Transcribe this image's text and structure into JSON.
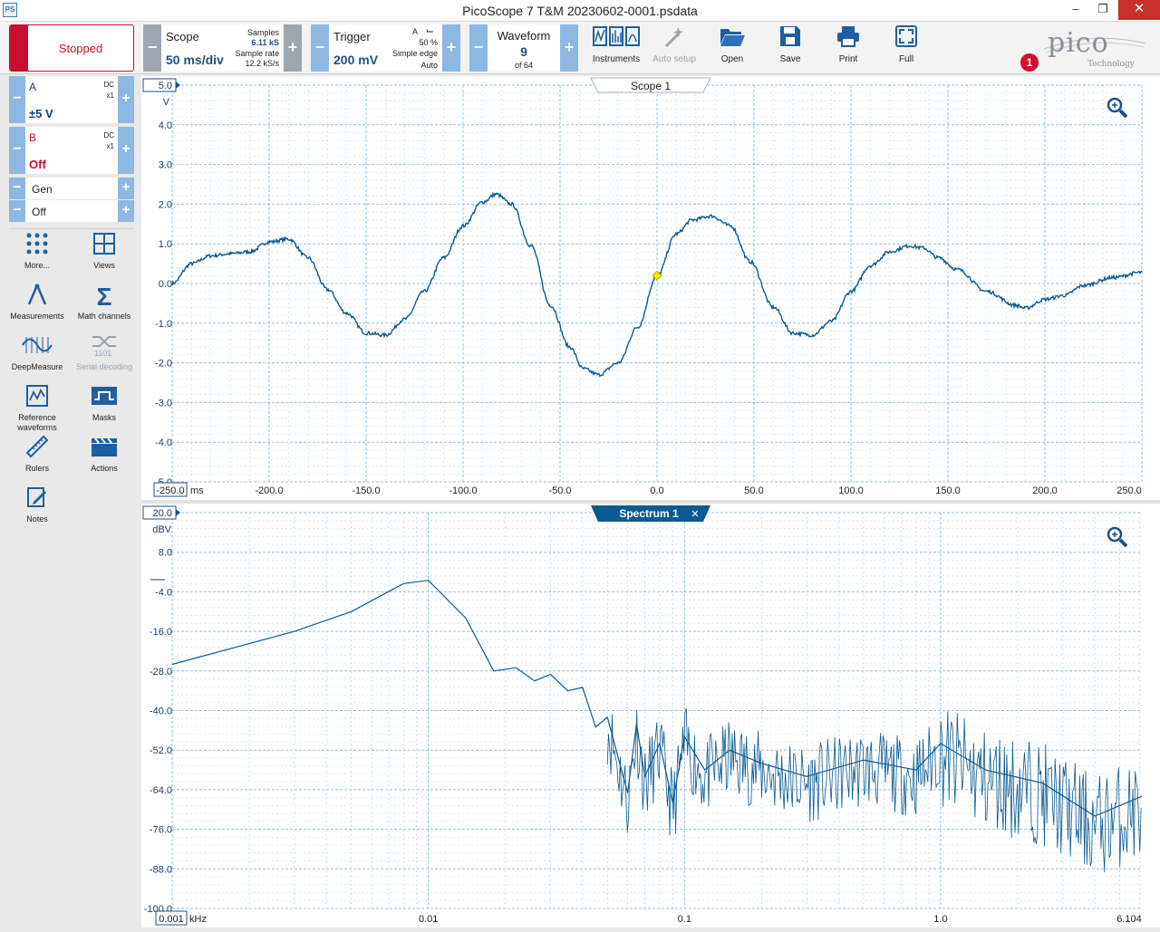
{
  "window": {
    "title": "PicoScope 7 T&M 20230602-0001.psdata",
    "app_icon": "PS"
  },
  "toolbar": {
    "status": "Stopped",
    "scope": {
      "title": "Scope",
      "value": "50 ms/div",
      "samples_label": "Samples",
      "samples_value": "6.11 kS",
      "rate_label": "Sample rate",
      "rate_value": "12.2 kS/s"
    },
    "trigger": {
      "title": "Trigger",
      "value": "200 mV",
      "channel": "A",
      "percent": "50 %",
      "type": "Simple edge",
      "mode": "Auto"
    },
    "waveform": {
      "title": "Waveform",
      "value": "9",
      "of": "of 64"
    },
    "buttons": [
      {
        "label": "Instruments",
        "icon": "instruments-icon"
      },
      {
        "label": "Auto setup",
        "icon": "auto-setup-icon"
      },
      {
        "label": "Open",
        "icon": "folder-open-icon"
      },
      {
        "label": "Save",
        "icon": "floppy-disk-icon"
      },
      {
        "label": "Print",
        "icon": "printer-icon"
      },
      {
        "label": "Full",
        "icon": "fullscreen-icon"
      }
    ],
    "logo": {
      "word": "pico",
      "sub": "Technology"
    },
    "notification_count": "1"
  },
  "channels": [
    {
      "name": "A",
      "coupling": "DC",
      "probe": "x1",
      "range": "±5 V",
      "color": "#1a3e66"
    },
    {
      "name": "B",
      "coupling": "DC",
      "probe": "x1",
      "range": "Off",
      "color": "#c8102e"
    }
  ],
  "generator": {
    "label": "Gen",
    "state": "Off"
  },
  "side_tools": [
    {
      "label": "More...",
      "icon": "more-dots-icon"
    },
    {
      "label": "Views",
      "icon": "views-grid-icon"
    },
    {
      "label": "Measurements",
      "icon": "measurements-icon"
    },
    {
      "label": "Math channels",
      "icon": "sigma-icon"
    },
    {
      "label": "DeepMeasure",
      "icon": "deepmeasure-icon"
    },
    {
      "label": "Serial decoding",
      "icon": "serial-decoding-icon"
    },
    {
      "label": "Reference waveforms",
      "icon": "reference-waveforms-icon"
    },
    {
      "label": "Masks",
      "icon": "masks-icon"
    },
    {
      "label": "Rulers",
      "icon": "ruler-icon"
    },
    {
      "label": "Actions",
      "icon": "clapperboard-icon"
    },
    {
      "label": "Notes",
      "icon": "notes-icon"
    }
  ],
  "chart_data": [
    {
      "type": "line",
      "title": "Scope 1",
      "ylabel": "V",
      "xlabel": "ms",
      "xlim": [
        -250,
        250
      ],
      "ylim": [
        -5,
        5
      ],
      "y_top_label": "5.0",
      "x_first_label": "-250.0",
      "x_ticks": [
        "-200.0",
        "-150.0",
        "-100.0",
        "-50.0",
        "0.0",
        "50.0",
        "100.0",
        "150.0",
        "200.0",
        "250.0"
      ],
      "y_ticks": [
        "4.0",
        "3.0",
        "2.0",
        "1.0",
        "0.0",
        "-1.0",
        "-2.0",
        "-3.0",
        "-4.0",
        "-5.0"
      ],
      "grid": true,
      "trigger_marker": {
        "x": 0,
        "y": 0.2
      },
      "series": [
        {
          "color": "#0b5a92",
          "x": [
            -250,
            -240,
            -230,
            -220,
            -210,
            -200,
            -190,
            -180,
            -170,
            -160,
            -150,
            -140,
            -130,
            -120,
            -110,
            -100,
            -90,
            -83,
            -75,
            -65,
            -55,
            -45,
            -38,
            -30,
            -20,
            -10,
            0,
            10,
            18,
            28,
            38,
            48,
            60,
            70,
            80,
            90,
            100,
            110,
            120,
            130,
            137,
            145,
            155,
            170,
            185,
            190,
            200,
            210,
            220,
            235,
            250
          ],
          "y": [
            0,
            0.5,
            0.7,
            0.75,
            0.8,
            1.05,
            1.12,
            0.65,
            -0.15,
            -0.75,
            -1.25,
            -1.3,
            -0.9,
            -0.2,
            0.65,
            1.45,
            2.05,
            2.25,
            2.0,
            0.95,
            -0.55,
            -1.6,
            -2.15,
            -2.3,
            -2.0,
            -1.1,
            0.2,
            1.25,
            1.6,
            1.7,
            1.45,
            0.55,
            -0.6,
            -1.25,
            -1.3,
            -0.95,
            -0.2,
            0.45,
            0.8,
            0.95,
            0.9,
            0.65,
            0.35,
            -0.2,
            -0.55,
            -0.62,
            -0.4,
            -0.3,
            -0.05,
            0.15,
            0.28
          ]
        }
      ]
    },
    {
      "type": "line",
      "title": "Spectrum 1",
      "ylabel": "dBV",
      "xlabel": "kHz",
      "x_scale": "log",
      "xlim": [
        0.001,
        6.104
      ],
      "ylim": [
        -100,
        20
      ],
      "y_top_label": "20.0",
      "x_first_label": "0.001",
      "x_ticks": [
        "0.01",
        "0.1",
        "1.0",
        "6.104"
      ],
      "y_ticks": [
        "8.0",
        "-4.0",
        "-16.0",
        "-28.0",
        "-40.0",
        "-52.0",
        "-64.0",
        "-76.0",
        "-88.0",
        "-100.0"
      ],
      "grid": true,
      "series": [
        {
          "color": "#0b5a92",
          "x": [
            0.001,
            0.003,
            0.005,
            0.008,
            0.01,
            0.014,
            0.018,
            0.022,
            0.026,
            0.03,
            0.035,
            0.04,
            0.045,
            0.05,
            0.06,
            0.065,
            0.07,
            0.08,
            0.09,
            0.1,
            0.12,
            0.15,
            0.2,
            0.3,
            0.5,
            0.8,
            1.0,
            1.5,
            2.5,
            4.0,
            6.104
          ],
          "y": [
            -26,
            -16,
            -10,
            -1.5,
            -0.5,
            -12,
            -28,
            -27,
            -31,
            -29,
            -34,
            -33,
            -45,
            -42,
            -65,
            -44,
            -60,
            -50,
            -68,
            -48,
            -58,
            -52,
            -56,
            -60,
            -55,
            -58,
            -50,
            -58,
            -62,
            -72,
            -66
          ]
        }
      ]
    }
  ]
}
